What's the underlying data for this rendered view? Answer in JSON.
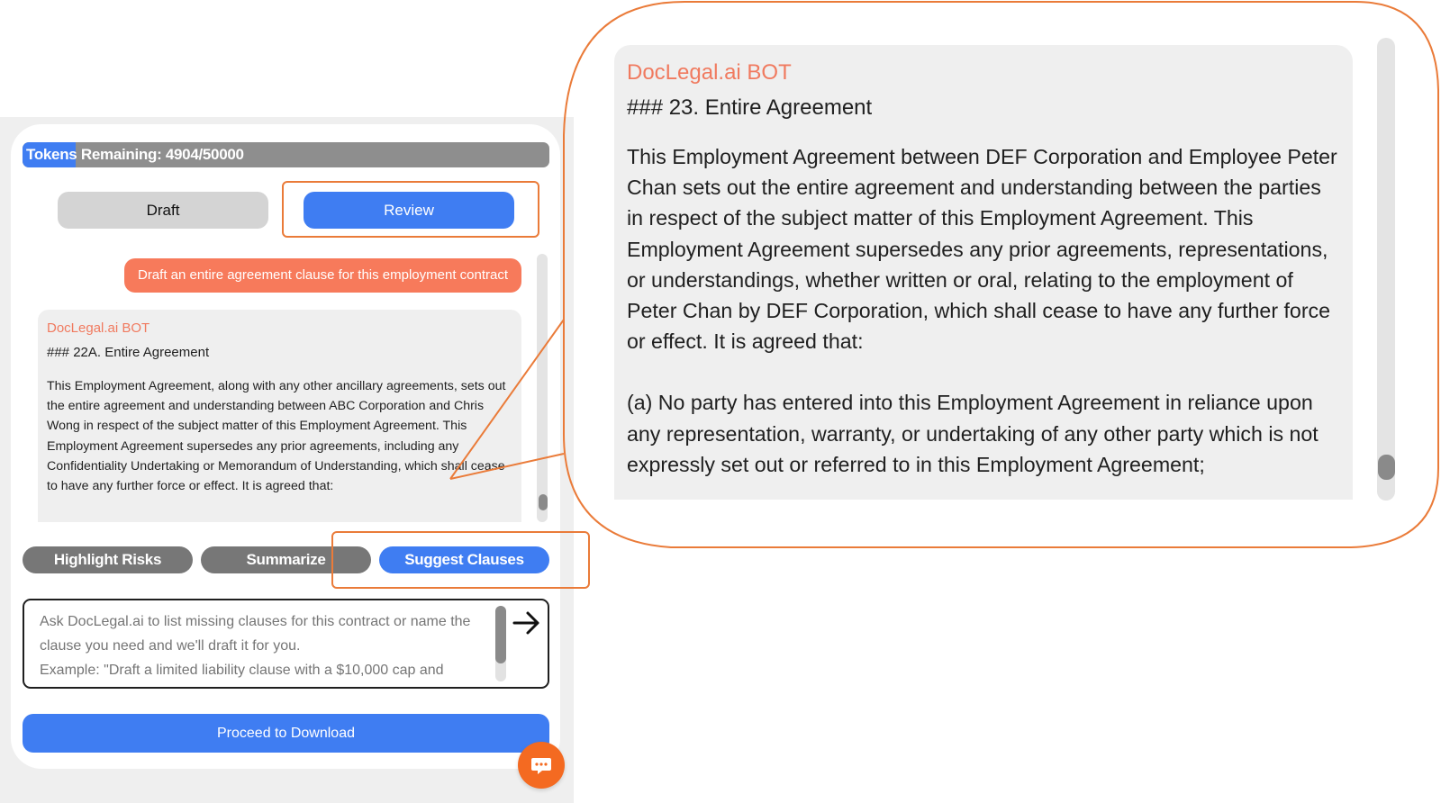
{
  "tokens": {
    "label": "Tokens Remaining: 4904/50000",
    "fraction_used": 0.1
  },
  "mode_tabs": {
    "draft": "Draft",
    "review": "Review"
  },
  "chat": {
    "user_message": "Draft an entire agreement clause for this employment contract",
    "bot": {
      "name": "DocLegal.ai BOT",
      "heading": "### 22A. Entire Agreement",
      "body": "This Employment Agreement, along with any other ancillary agreements, sets out the entire agreement and understanding between ABC Corporation and Chris Wong in respect of the subject matter of this Employment Agreement. This Employment Agreement supersedes any prior agreements, including any Confidentiality Undertaking or Memorandum of Understanding, which shall cease to have any further force or effect. It is agreed that:"
    }
  },
  "actions": {
    "highlight_risks": "Highlight Risks",
    "summarize": "Summarize",
    "suggest_clauses": "Suggest Clauses"
  },
  "input": {
    "placeholder": "Ask DocLegal.ai to list missing clauses for this contract or name the clause you need and we'll draft it for you.\nExample: \"Draft a limited liability clause with a $10,000 cap and"
  },
  "download_button": "Proceed to Download",
  "zoom": {
    "bot_name": "DocLegal.ai BOT",
    "heading": "### 23. Entire Agreement",
    "paragraph1": "This Employment Agreement between DEF Corporation and Employee Peter Chan sets out the entire agreement and understanding between the parties in respect of the subject matter of this Employment Agreement. This Employment Agreement supersedes any prior agreements, representations, or understandings, whether written or oral, relating to the employment of Peter Chan by DEF Corporation, which shall cease to have any further force or effect. It is agreed that:",
    "paragraph2": "(a) No party has entered into this Employment Agreement in reliance upon any representation, warranty, or undertaking of any other party which is not expressly set out or referred to in this Employment Agreement;"
  },
  "colors": {
    "primary_blue": "#3f7df2",
    "accent_orange": "#ea7b39",
    "user_bubble": "#f77a5b",
    "bot_name": "#f07a5f",
    "fab": "#f46a21",
    "gray_button": "#777777"
  },
  "icons": {
    "send": "arrow-right-icon",
    "chat_fab": "chat-bubble-icon"
  }
}
